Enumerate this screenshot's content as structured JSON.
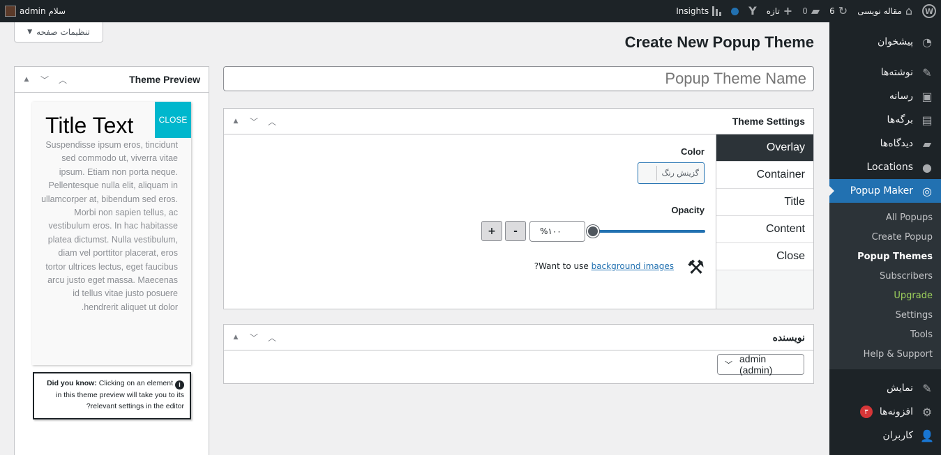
{
  "adminbar": {
    "site_name": "مقاله نویسی",
    "updates_count": "6",
    "comments_count": "0",
    "new_label": "تازه",
    "insights_label": "Insights",
    "greeting": "سلام admin"
  },
  "screen_options": {
    "label": "تنظیمات صفحه"
  },
  "page_title": "Create New Popup Theme",
  "title_input": {
    "placeholder": "Popup Theme Name"
  },
  "sidebar": {
    "items_top": [
      {
        "label": "پیشخوان",
        "icon": "◔"
      },
      {
        "label": "نوشته‌ها",
        "icon": "✎"
      },
      {
        "label": "رسانه",
        "icon": "▣"
      },
      {
        "label": "برگه‌ها",
        "icon": "▤"
      },
      {
        "label": "دیدگاه‌ها",
        "icon": "▰"
      },
      {
        "label": "Locations",
        "icon": "●"
      }
    ],
    "active": {
      "label": "Popup Maker",
      "icon": "◎"
    },
    "submenu": [
      "All Popups",
      "Create Popup",
      "Popup Themes",
      "Subscribers",
      "Upgrade",
      "Settings",
      "Tools",
      "Help & Support"
    ],
    "items_bottom": [
      {
        "label": "نمایش",
        "icon": "✎"
      },
      {
        "label": "افزونه‌ها",
        "icon": "⚙",
        "badge": "۳"
      },
      {
        "label": "کاربران",
        "icon": "👤"
      }
    ]
  },
  "theme_settings": {
    "title": "Theme Settings",
    "tabs": [
      "Overlay",
      "Container",
      "Title",
      "Content",
      "Close"
    ],
    "color_label": "Color",
    "color_button": "گزینش رنگ",
    "opacity_label": "Opacity",
    "opacity_value": "%۱۰۰",
    "opacity_fraction": 1.0,
    "minus_label": "-",
    "plus_label": "+",
    "bg_question_prefix": "Want to use",
    "bg_link": "background images",
    "bg_question_suffix": "?"
  },
  "author_box": {
    "title": "نویسنده",
    "selected": "admin (admin)"
  },
  "preview": {
    "title": "Theme Preview",
    "popup_title": "Title Text",
    "close_label": "CLOSE",
    "body": "Suspendisse ipsum eros, tincidunt sed commodo ut, viverra vitae ipsum. Etiam non porta neque. Pellentesque nulla elit, aliquam in ullamcorper at, bibendum sed eros. Morbi non sapien tellus, ac vestibulum eros. In hac habitasse platea dictumst. Nulla vestibulum, diam vel porttitor placerat, eros tortor ultrices lectus, eget faucibus arcu justo eget massa. Maecenas id tellus vitae justo posuere hendrerit aliquet ut dolor.",
    "tip_bold": "Did you know:",
    "tip_text": "Clicking on an element in this theme preview will take you to its relevant settings in the editor?"
  }
}
